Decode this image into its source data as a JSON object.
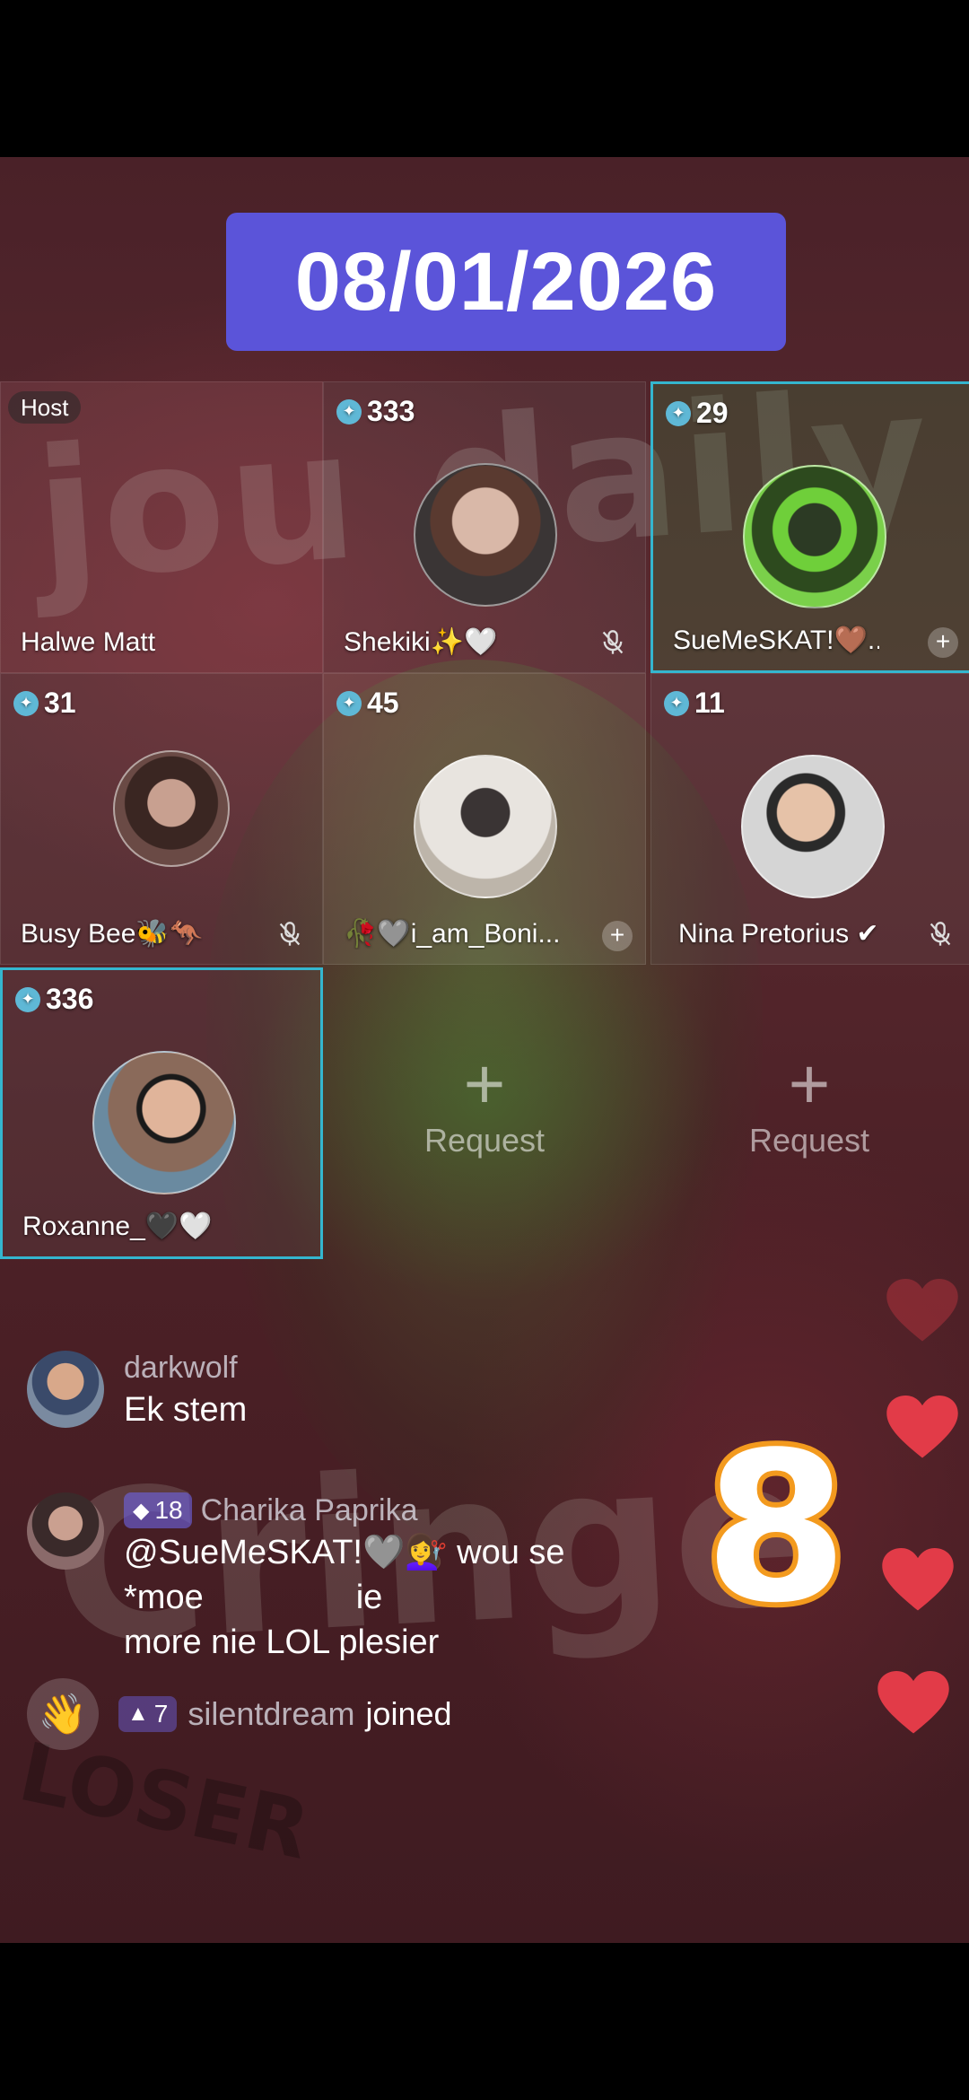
{
  "date_overlay": "08/01/2026",
  "counter_overlay": "8",
  "colors": {
    "accent": "#5b54d9",
    "active_border": "#34b6cf",
    "counter_outline": "#f39a1e",
    "heart": "#e23b48"
  },
  "tiles": [
    {
      "host_label": "Host",
      "name": "Halwe Matt"
    },
    {
      "score": "333",
      "name": "Shekiki✨🤍",
      "icon": "mic-off-icon"
    },
    {
      "score": "29",
      "name": "SueMeSKAT!🤎...",
      "icon": "plus-icon"
    },
    {
      "score": "31",
      "name": "Busy Bee🐝🦘",
      "icon": "mic-off-icon"
    },
    {
      "score": "45",
      "name": "🥀🩶i_am_Boni...",
      "icon": "plus-icon"
    },
    {
      "score": "11",
      "name": "Nina Pretorius ✔",
      "icon": "mic-off-icon"
    },
    {
      "score": "336",
      "name": "Roxanne_🖤🤍"
    }
  ],
  "request_slots": [
    {
      "plus": "+",
      "label": "Request"
    },
    {
      "plus": "+",
      "label": "Request"
    }
  ],
  "chat": [
    {
      "user": "darkwolf",
      "text": "Ek stem"
    },
    {
      "user": "Charika Paprika",
      "level": "18",
      "text_line1": "@SueMeSKAT!🩶💇‍♀️ wou se *moe",
      "text_fragment": "ie",
      "text_line2": "more nie LOL plesier"
    },
    {
      "user": "silentdream",
      "level": "7",
      "action": "joined"
    }
  ]
}
